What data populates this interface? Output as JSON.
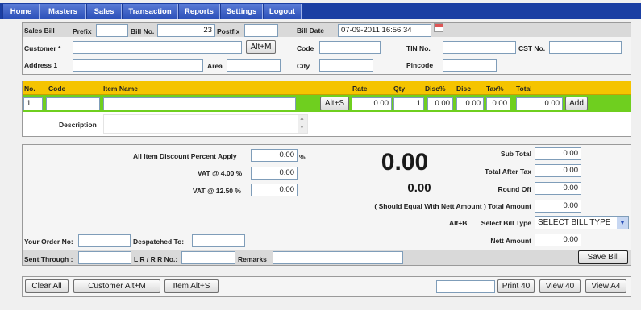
{
  "menu": [
    "Home",
    "Masters",
    "Sales",
    "Transaction",
    "Reports",
    "Settings",
    "Logout"
  ],
  "header": {
    "sales_bill": "Sales Bill",
    "prefix_label": "Prefix",
    "prefix_value": "",
    "billno_label": "Bill No.",
    "billno_value": "23",
    "postfix_label": "Postfix",
    "postfix_value": "",
    "billdate_label": "Bill Date",
    "billdate_value": "07-09-2011 16:56:34",
    "customer_label": "Customer *",
    "customer_value": "",
    "altm_button": "Alt+M",
    "code_label": "Code",
    "tin_label": "TIN No.",
    "cst_label": "CST No.",
    "address_label": "Address 1",
    "area_label": "Area",
    "city_label": "City",
    "pincode_label": "Pincode"
  },
  "items": {
    "columns": [
      "No.",
      "Code",
      "Item Name",
      "Rate",
      "Qty",
      "Disc%",
      "Disc",
      "Tax%",
      "Total"
    ],
    "row": {
      "no": "1",
      "code": "",
      "name": "",
      "alts_button": "Alt+S",
      "rate": "0.00",
      "qty": "1",
      "discp": "0.00",
      "disc": "0.00",
      "taxp": "0.00",
      "total": "0.00",
      "add_button": "Add"
    },
    "description_label": "Description"
  },
  "summary": {
    "all_disc_label": "All Item Discount Percent Apply",
    "all_disc_value": "0.00",
    "percent_sign": "%",
    "vat4_label": "VAT @ 4.00 %",
    "vat4_value": "0.00",
    "vat125_label": "VAT @ 12.50 %",
    "vat125_value": "0.00",
    "big_total": "0.00",
    "small_total": "0.00",
    "subtotal_label": "Sub Total",
    "subtotal_value": "0.00",
    "after_tax_label": "Total After Tax",
    "after_tax_value": "0.00",
    "roundoff_label": "Round Off",
    "roundoff_value": "0.00",
    "total_amount_label": "( Should Equal With Nett Amount ) Total Amount",
    "total_amount_value": "0.00",
    "altb_label": "Alt+B",
    "bill_type_label": "Select Bill Type",
    "bill_type_value": "SELECT BILL TYPE",
    "nett_label": "Nett Amount",
    "nett_value": "0.00",
    "order_label": "Your Order No:",
    "despatched_label": "Despatched To:",
    "sent_label": "Sent Through :",
    "lr_label": "L R / R R No.:",
    "remarks_label": "Remarks",
    "save_button": "Save Bill"
  },
  "footer": {
    "clear_all": "Clear All",
    "customer_altm": "Customer Alt+M",
    "item_alts": "Item Alt+S",
    "print40": "Print 40",
    "view40": "View 40",
    "viewa4": "View A4"
  },
  "colors": {
    "menu_bg": "#1b3fa3",
    "grid_header": "#f5c400",
    "grid_row": "#6fcf1f"
  }
}
